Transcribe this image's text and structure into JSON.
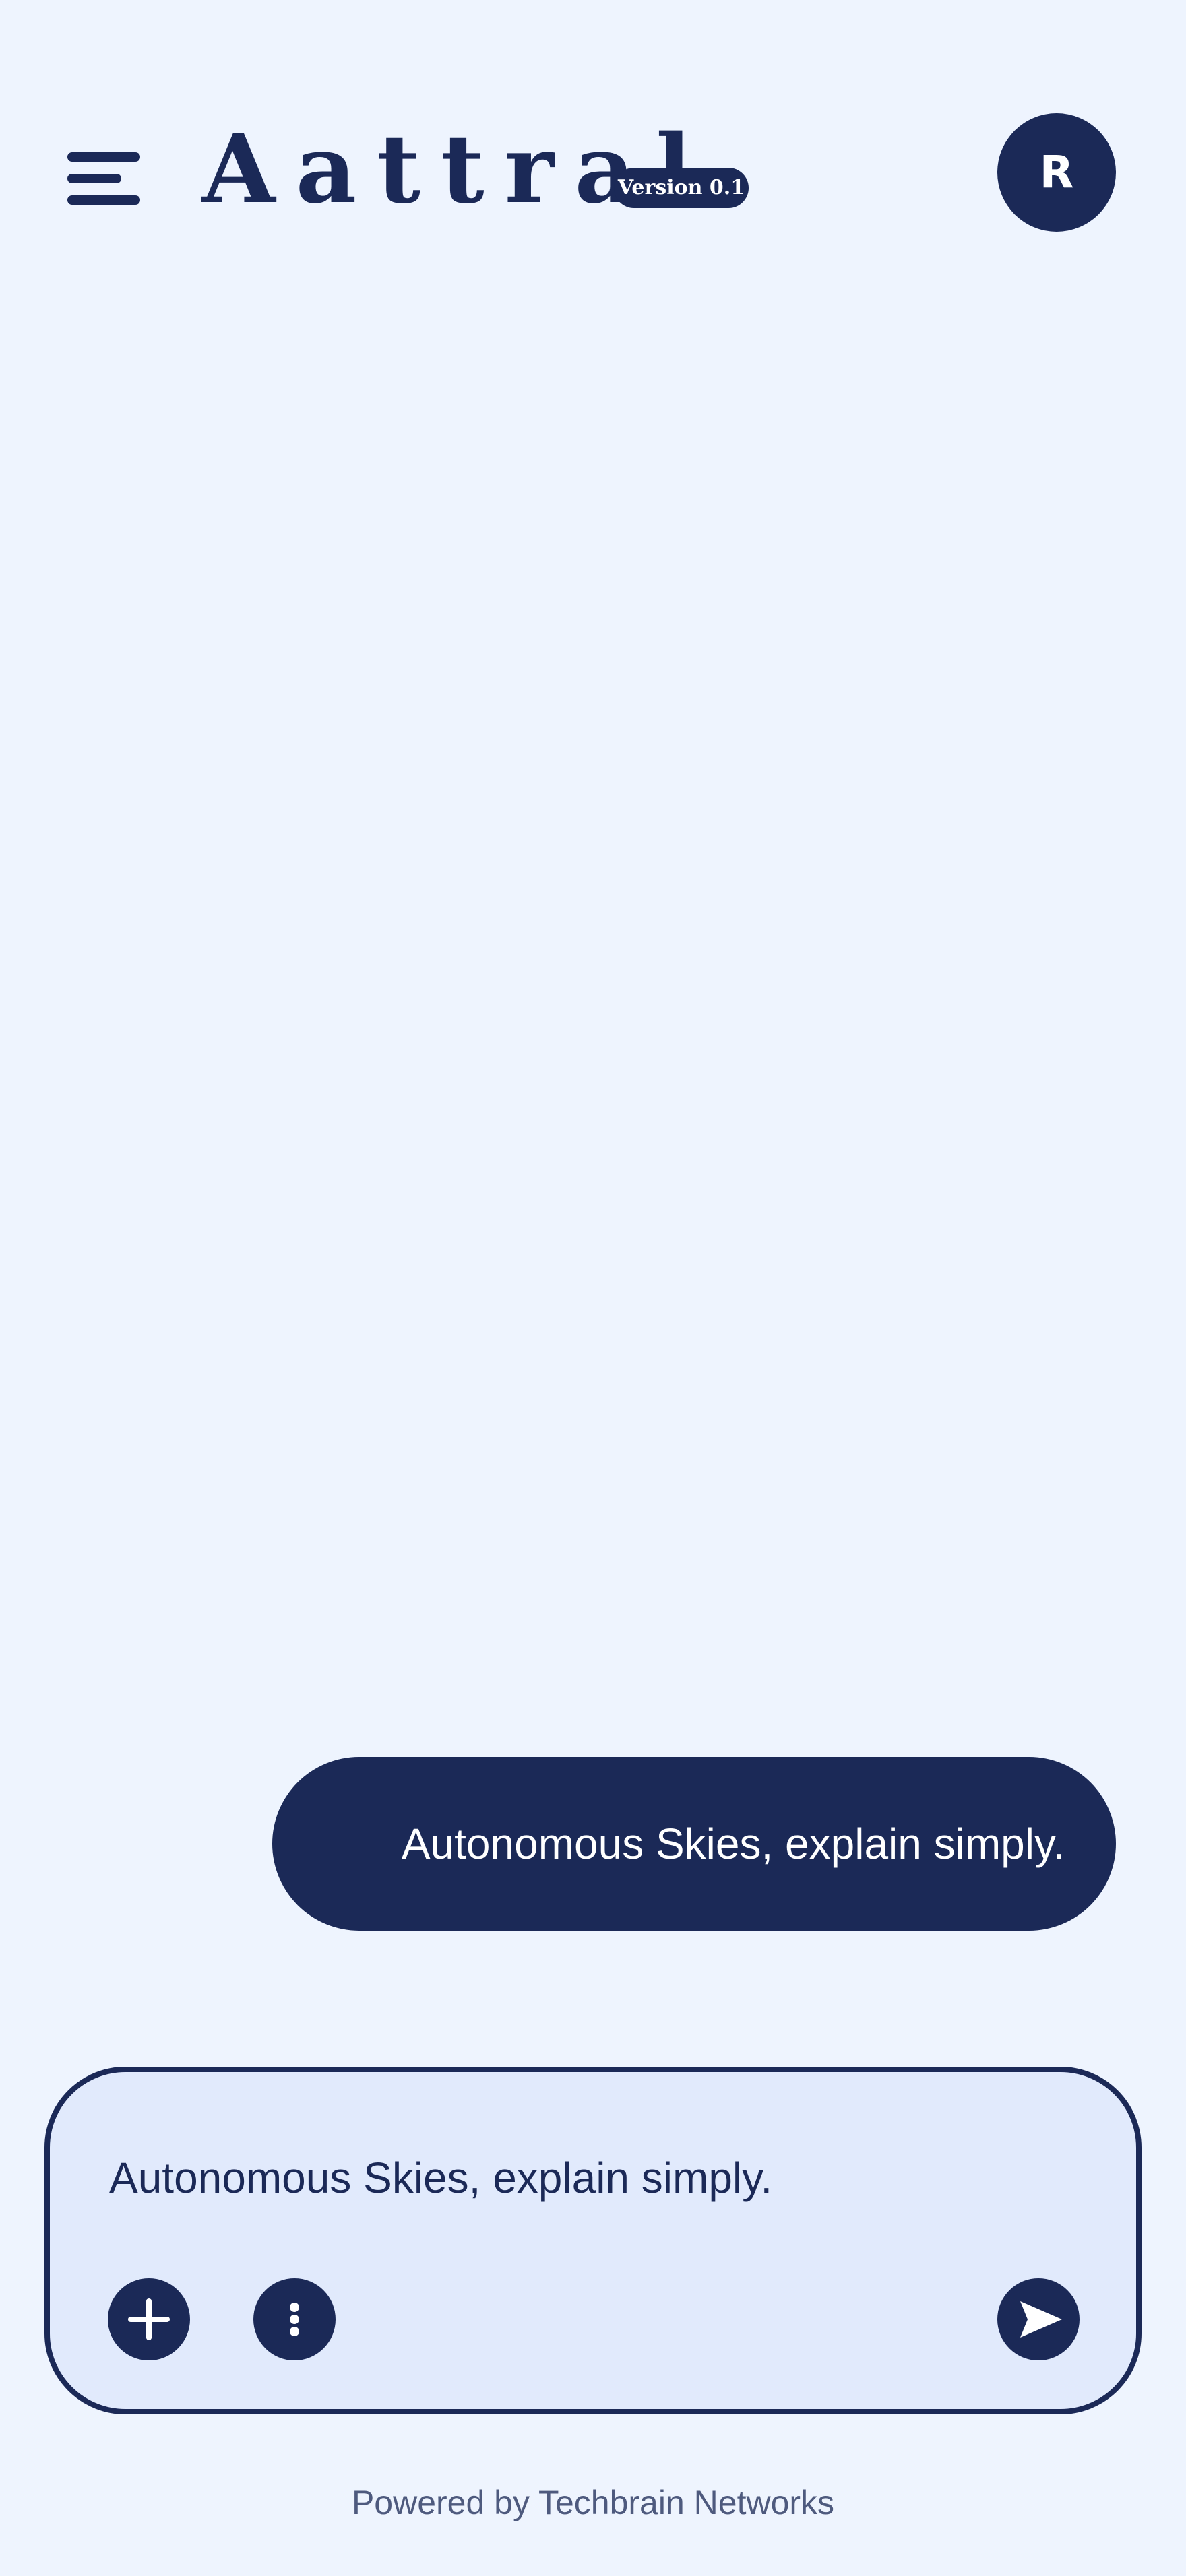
{
  "header": {
    "menu_icon": "hamburger-menu-icon",
    "logo_text": "Aattral",
    "version_badge": "Version 0.1",
    "avatar_initial": "R"
  },
  "chat": {
    "messages": [
      {
        "role": "user",
        "text": "Autonomous Skies, explain simply."
      }
    ]
  },
  "composer": {
    "input_value": "Autonomous Skies, explain simply.",
    "add_icon": "plus-icon",
    "more_icon": "more-vertical-icon",
    "send_icon": "send-icon"
  },
  "footer": {
    "powered_by": "Powered by Techbrain Networks"
  },
  "colors": {
    "background": "#eef4fe",
    "primary": "#1b2957",
    "composer_bg": "#e1eafc",
    "footer_text": "#4e5a7e"
  }
}
